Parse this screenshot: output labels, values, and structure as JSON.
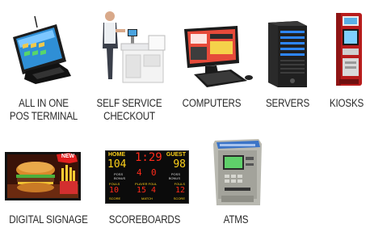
{
  "products": [
    {
      "id": "pos",
      "lines": [
        "ALL IN ONE",
        "POS TERMINAL"
      ]
    },
    {
      "id": "self",
      "lines": [
        "SELF SERVICE",
        "CHECKOUT"
      ]
    },
    {
      "id": "computers",
      "lines": [
        "COMPUTERS"
      ]
    },
    {
      "id": "servers",
      "lines": [
        "SERVERS"
      ]
    },
    {
      "id": "kiosks",
      "lines": [
        "KIOSKS"
      ]
    },
    {
      "id": "signage",
      "lines": [
        "DIGITAL SIGNAGE"
      ]
    },
    {
      "id": "scoreboards",
      "lines": [
        "SCOREBOARDS"
      ]
    },
    {
      "id": "atms",
      "lines": [
        "ATMS"
      ]
    }
  ],
  "signage_badge": "NEW",
  "scoreboard": {
    "home_label": "HOME",
    "guest_label": "GUEST",
    "clock": "1:29",
    "home_score": "104",
    "guest_score": "98",
    "period": "4",
    "down": "0",
    "fouls_label": "FOULS",
    "player_foul_label": "PLAYER FOUL",
    "home_fouls": "10",
    "player_number": "15",
    "player_fouls": "4",
    "guest_fouls": "12",
    "poss_label": "POSS",
    "bonus_label": "BONUS",
    "score_label": "SCORE",
    "match_label": "MATCH"
  },
  "colors": {
    "label_text": "#2a2a2a",
    "led_red": "#ff2a1a",
    "led_yellow": "#ffd21a",
    "kiosk_red": "#c21d1d"
  }
}
